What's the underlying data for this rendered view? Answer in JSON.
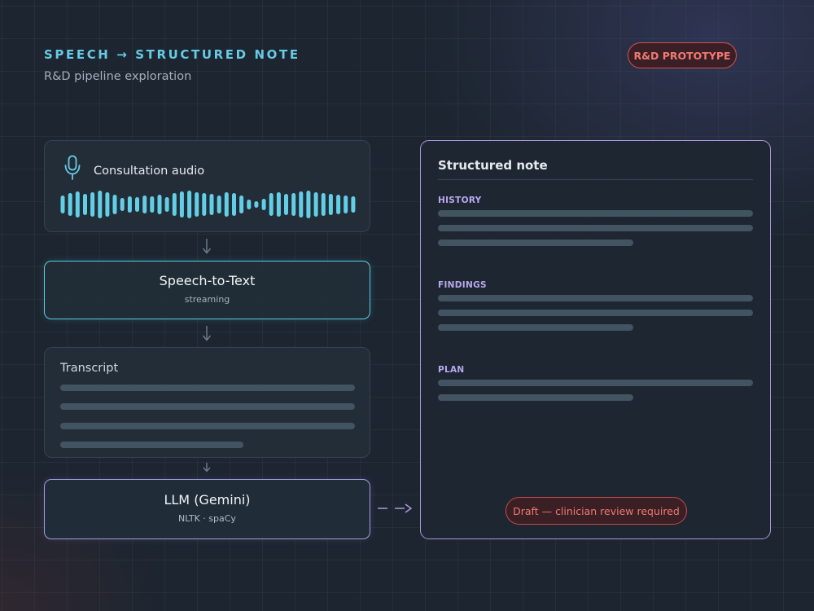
{
  "header": {
    "title": "SPEECH → STRUCTURED NOTE",
    "subtitle": "R&D pipeline exploration",
    "badge": "R&D PROTOTYPE"
  },
  "pipeline": {
    "audio": {
      "label": "Consultation audio",
      "icon": "microphone-icon"
    },
    "speech_to_text": {
      "title": "Speech-to-Text",
      "subtitle": "streaming"
    },
    "transcript": {
      "label": "Transcript"
    },
    "llm": {
      "title": "LLM (Gemini)",
      "subtitle": "NLTK · spaCy"
    }
  },
  "note": {
    "title": "Structured note",
    "sections": [
      {
        "label": "HISTORY"
      },
      {
        "label": "FINDINGS"
      },
      {
        "label": "PLAN"
      }
    ],
    "status": "Draft — clinician review required"
  },
  "colors": {
    "accent_cyan": "#5ccbe2",
    "accent_violet": "#a99ae0",
    "warning_red": "#d5504c",
    "placeholder_line": "#425462"
  }
}
